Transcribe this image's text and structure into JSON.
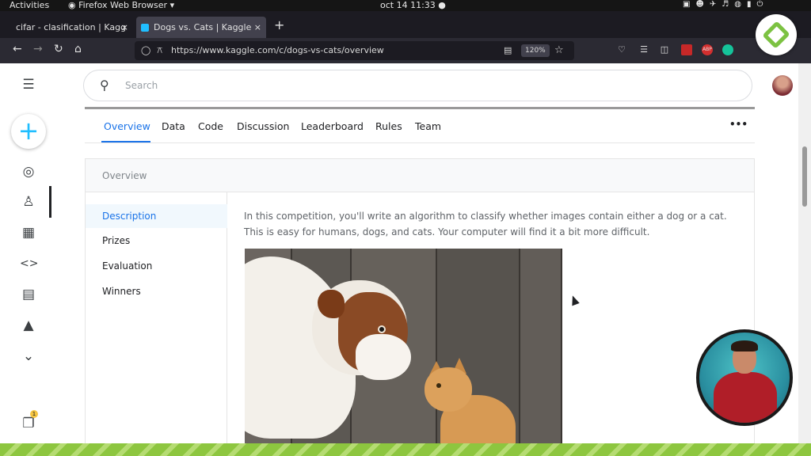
{
  "os_bar": {
    "activities": "Activities",
    "app_name": "Firefox Web Browser",
    "clock": "oct 14  11:33",
    "tray_icons": [
      "zoom-icon",
      "network-icon",
      "airplane-icon",
      "volume-icon",
      "mic-icon",
      "battery-icon",
      "power-icon"
    ]
  },
  "browser": {
    "tabs": [
      {
        "label": "cifar - clasification | Kagg",
        "close": "×"
      },
      {
        "label": "Dogs vs. Cats | Kaggle",
        "close": "×"
      }
    ],
    "new_tab": "+",
    "url": "https://www.kaggle.com/c/dogs-vs-cats/overview",
    "zoom": "120%",
    "extensions": [
      "pocket-icon",
      "library-icon",
      "sidebar-icon",
      "ext-red-icon",
      "abp-icon",
      "grammarly-icon"
    ]
  },
  "kaggle": {
    "search_placeholder": "Search",
    "competition_tabs": [
      "Overview",
      "Data",
      "Code",
      "Discussion",
      "Leaderboard",
      "Rules",
      "Team"
    ],
    "active_tab": "Overview",
    "more": "•••",
    "section_title": "Overview",
    "subnav": [
      "Description",
      "Prizes",
      "Evaluation",
      "Winners"
    ],
    "active_subnav": "Description",
    "description": "In this competition, you'll write an algorithm to classify whether images contain either a dog or a cat.  This is easy for humans, dogs, and cats. Your computer will find it a bit more difficult.",
    "notification_count": "1",
    "accent_color": "#20beff"
  }
}
